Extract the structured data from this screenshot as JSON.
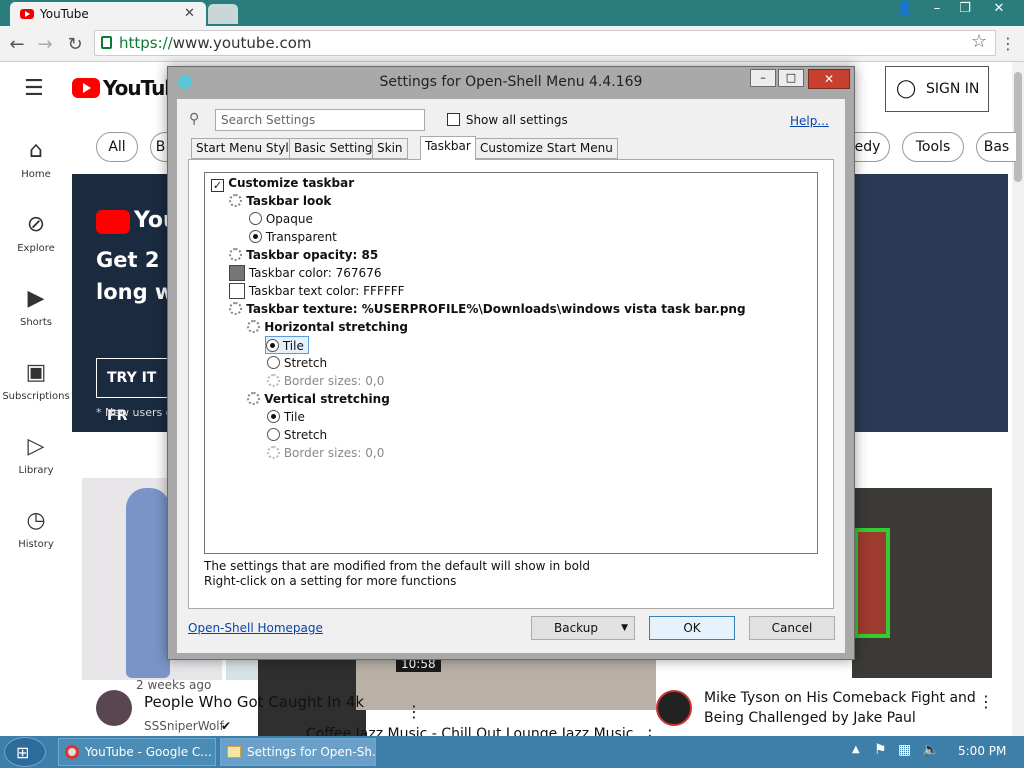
{
  "browser": {
    "tab_title": "YouTube",
    "url_scheme": "https://",
    "url_host": "www.youtube.com"
  },
  "youtube": {
    "logo": "YouTube",
    "sign_in": "SIGN IN",
    "sidebar": [
      {
        "label": "Home",
        "icon": "home-icon"
      },
      {
        "label": "Explore",
        "icon": "compass-icon"
      },
      {
        "label": "Shorts",
        "icon": "shorts-icon"
      },
      {
        "label": "Subscriptions",
        "icon": "subscriptions-icon"
      },
      {
        "label": "Library",
        "icon": "library-icon"
      },
      {
        "label": "History",
        "icon": "history-icon"
      }
    ],
    "chips": [
      "All",
      "B",
      "edy",
      "Tools",
      "Bas"
    ],
    "banner": {
      "brand": "YouTu",
      "headline_1": "Get 2 f",
      "headline_2": "long wh",
      "cta": "TRY IT FR",
      "footnote": "* New users o"
    },
    "videos": [
      {
        "age": "2 weeks ago",
        "title": "People Who Got Caught In 4k",
        "channel": "SSSniperWolf"
      },
      {
        "duration": "10:58",
        "title": "Coffee Jazz Music - Chill Out Lounge Jazz Music"
      },
      {
        "title_1": "Mike Tyson on His Comeback Fight and",
        "title_2": "Being Challenged by Jake Paul"
      }
    ]
  },
  "dialog": {
    "title": "Settings for Open-Shell Menu 4.4.169",
    "search_placeholder": "Search Settings",
    "show_all": "Show all settings",
    "help": "Help...",
    "tabs": [
      "Start Menu Style",
      "Basic Settings",
      "Skin",
      "Taskbar",
      "Customize Start Menu"
    ],
    "active_tab": "Taskbar",
    "tree": {
      "customize": "Customize taskbar",
      "look": "Taskbar look",
      "opaque": "Opaque",
      "transparent": "Transparent",
      "opacity": "Taskbar opacity: 85",
      "color": "Taskbar color: 767676",
      "text_color": "Taskbar text color: FFFFFF",
      "texture": "Taskbar texture: %USERPROFILE%\\Downloads\\windows vista task bar.png",
      "h_stretch": "Horizontal stretching",
      "tile": "Tile",
      "stretch": "Stretch",
      "border": "Border sizes: 0,0",
      "v_stretch": "Vertical stretching"
    },
    "swatch_color": "#767676",
    "text_swatch_color": "#FFFFFF",
    "note_1": "The settings that are modified from the default will show in bold",
    "note_2": "Right-click on a setting for more functions",
    "homepage": "Open-Shell Homepage",
    "backup": "Backup",
    "ok": "OK",
    "cancel": "Cancel"
  },
  "taskbar": {
    "items": [
      "YouTube - Google C...",
      "Settings for Open-Sh..."
    ],
    "clock": "5:00 PM"
  }
}
